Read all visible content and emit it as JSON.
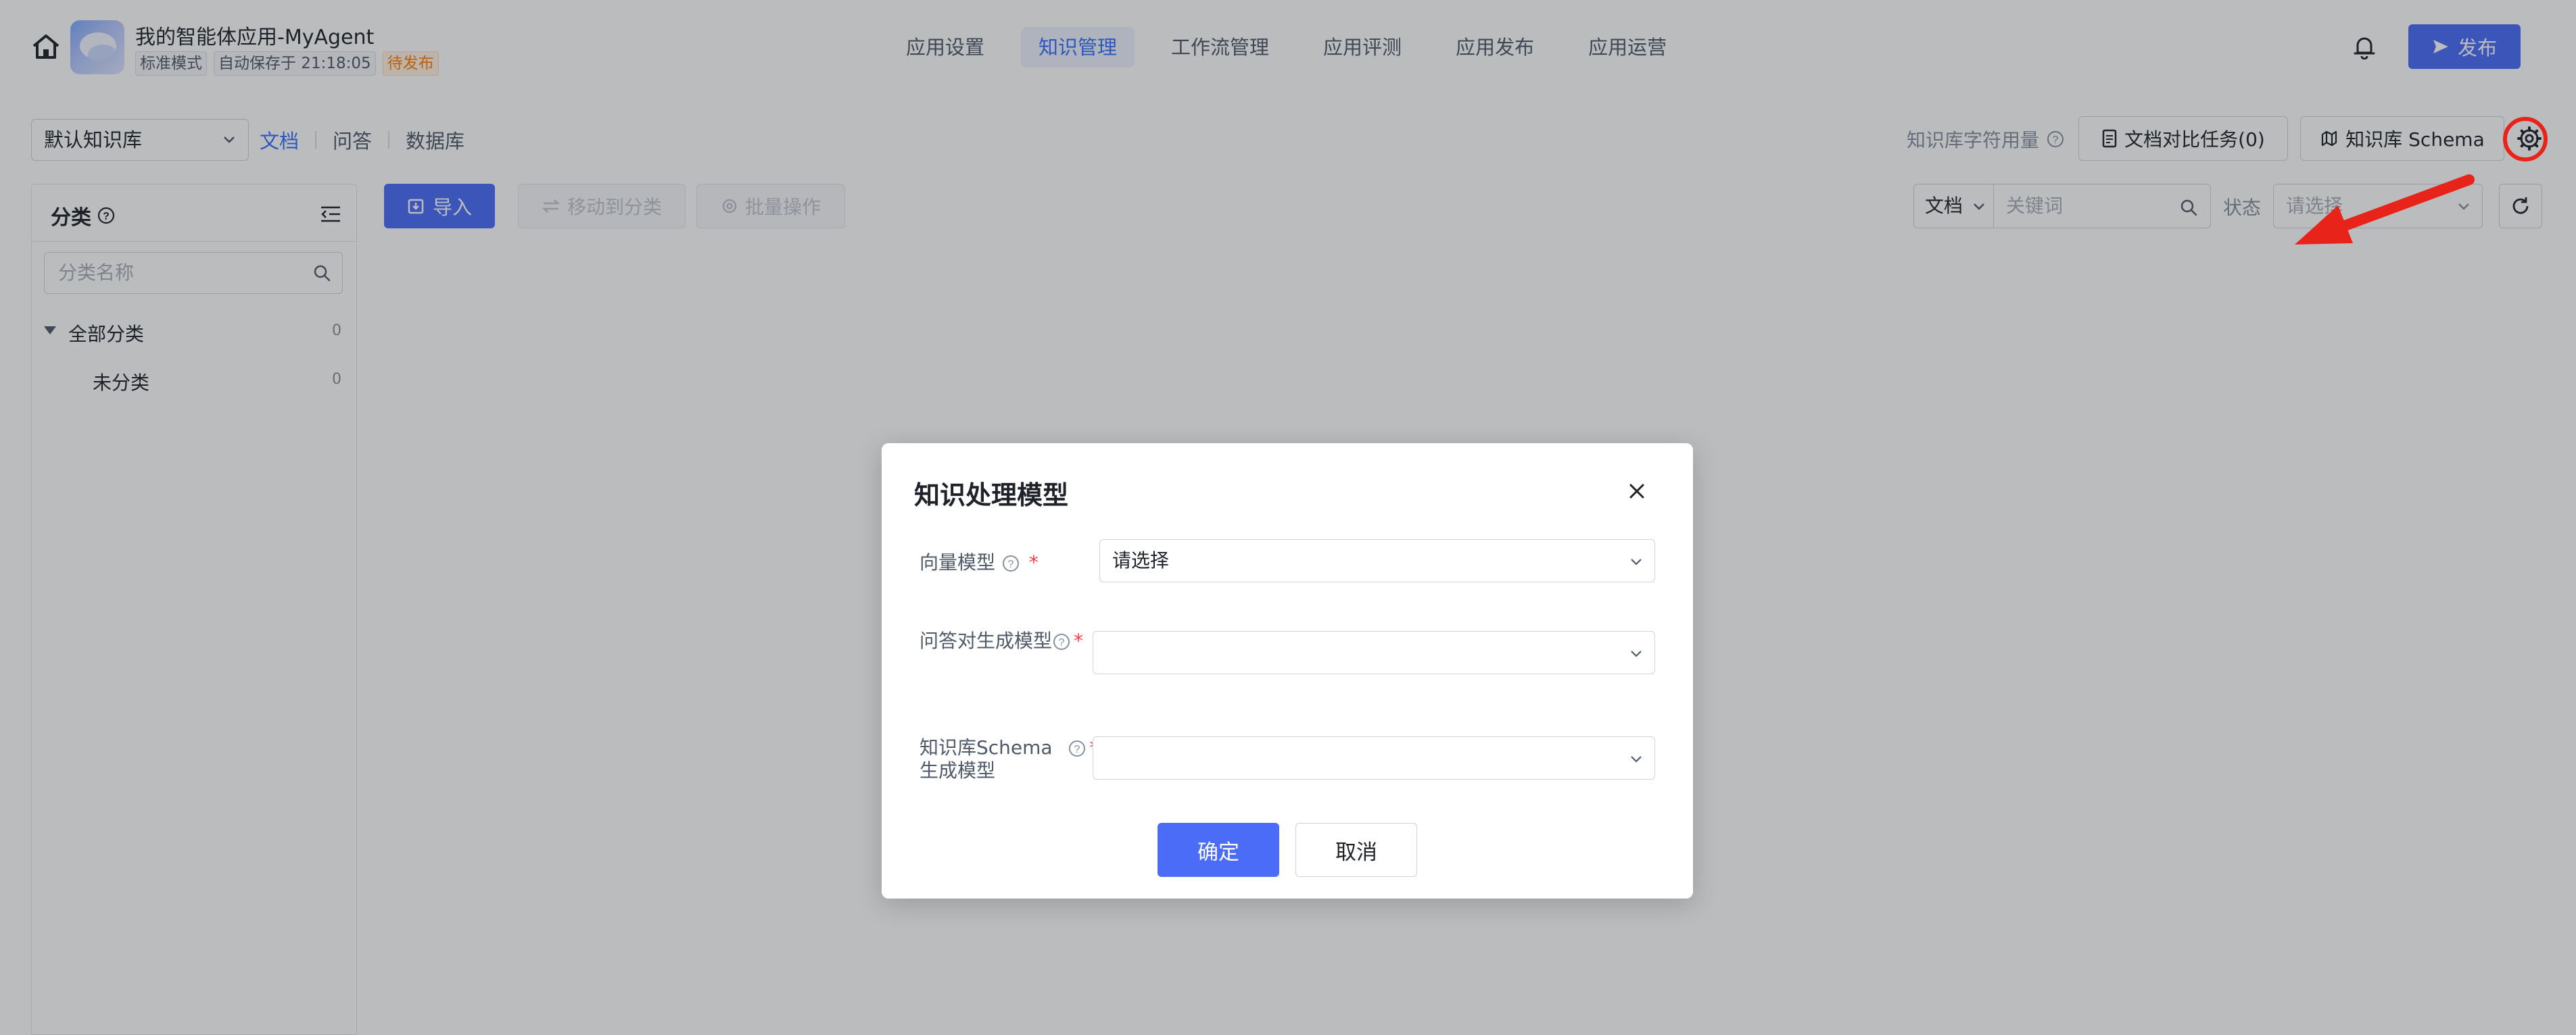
{
  "header": {
    "app_title": "我的智能体应用-MyAgent",
    "mode_tag": "标准模式",
    "autosave_tag": "自动保存于 21:18:05",
    "status_tag": "待发布",
    "nav": [
      {
        "label": "应用设置",
        "active": false
      },
      {
        "label": "知识管理",
        "active": true
      },
      {
        "label": "工作流管理",
        "active": false
      },
      {
        "label": "应用评测",
        "active": false
      },
      {
        "label": "应用发布",
        "active": false
      },
      {
        "label": "应用运营",
        "active": false
      }
    ],
    "publish_label": "发布",
    "icons": {
      "home": "home-icon",
      "bell": "bell-icon",
      "send": "send-icon"
    }
  },
  "knowledge_bar": {
    "kb_select_value": "默认知识库",
    "subtabs": [
      {
        "label": "文档",
        "active": true
      },
      {
        "label": "问答",
        "active": false
      },
      {
        "label": "数据库",
        "active": false
      }
    ],
    "quota_label": "知识库字符用量",
    "compare_task_label": "文档对比任务(0)",
    "schema_label": "知识库 Schema",
    "settings_icon": "gear-icon"
  },
  "sidebar": {
    "title": "分类",
    "search_placeholder": "分类名称",
    "tree": [
      {
        "label": "全部分类",
        "count": "0",
        "expanded": true
      },
      {
        "label": "未分类",
        "count": "0"
      }
    ]
  },
  "toolbar": {
    "import_label": "导入",
    "move_label": "移动到分类",
    "batch_label": "批量操作",
    "filter_type": "文档",
    "keyword_placeholder": "关键词",
    "status_label": "状态",
    "status_placeholder": "请选择"
  },
  "modal": {
    "title": "知识处理模型",
    "fields": [
      {
        "label": "向量模型",
        "value": "请选择",
        "required": true
      },
      {
        "label": "问答对生成模型",
        "value": "",
        "required": true
      },
      {
        "label_line1": "知识库Schema",
        "label_line2": "生成模型",
        "value": "",
        "required": true
      }
    ],
    "ok_label": "确定",
    "cancel_label": "取消"
  },
  "colors": {
    "primary": "#4a6cf7",
    "link": "#3370ff",
    "warning": "#ff7d00",
    "annotation": "#e8231a"
  }
}
